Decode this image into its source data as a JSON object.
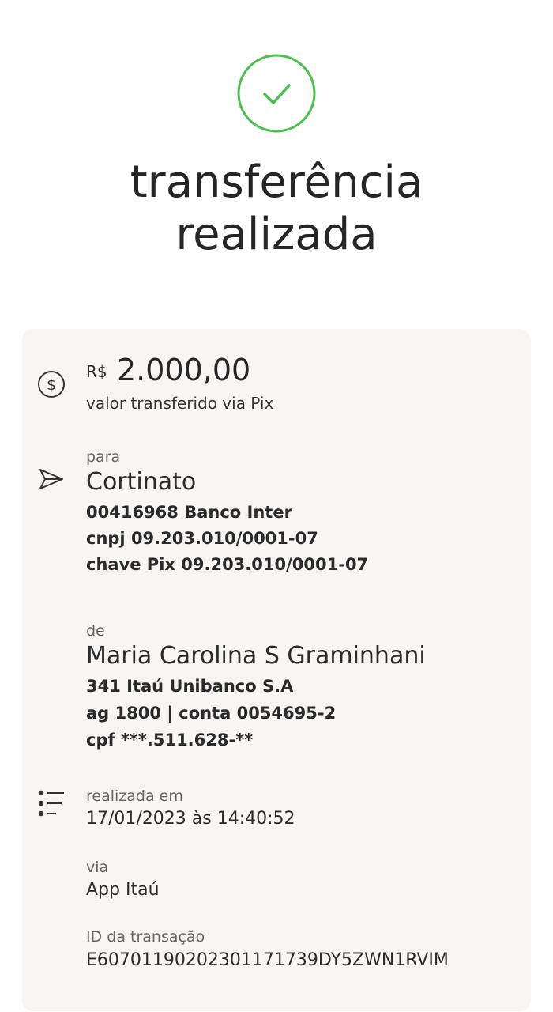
{
  "header": {
    "title_line1": "transferência",
    "title_line2": "realizada"
  },
  "amount": {
    "currency": "R$",
    "value": "2.000,00",
    "description": "valor transferido via Pix"
  },
  "recipient": {
    "label": "para",
    "name": "Cortinato",
    "bank": "00416968 Banco Inter",
    "cnpj": "cnpj 09.203.010/0001-07",
    "pix_key": "chave Pix 09.203.010/0001-07"
  },
  "sender": {
    "label": "de",
    "name": "Maria Carolina S Graminhani",
    "bank": "341 Itaú Unibanco S.A",
    "account": "ag 1800 | conta 0054695-2",
    "cpf": "cpf ***.511.628-**"
  },
  "details": {
    "date_label": "realizada em",
    "date_value": "17/01/2023 às 14:40:52",
    "via_label": "via",
    "via_value": "App Itaú",
    "id_label": "ID da transação",
    "id_value": "E60701190202301171739DY5ZWN1RVIM"
  },
  "colors": {
    "success": "#4cc04c",
    "card_bg": "#f8f6f4"
  },
  "icons": {
    "status": "check-circle-icon",
    "amount": "dollar-circle-icon",
    "recipient": "send-icon",
    "details": "list-icon"
  }
}
